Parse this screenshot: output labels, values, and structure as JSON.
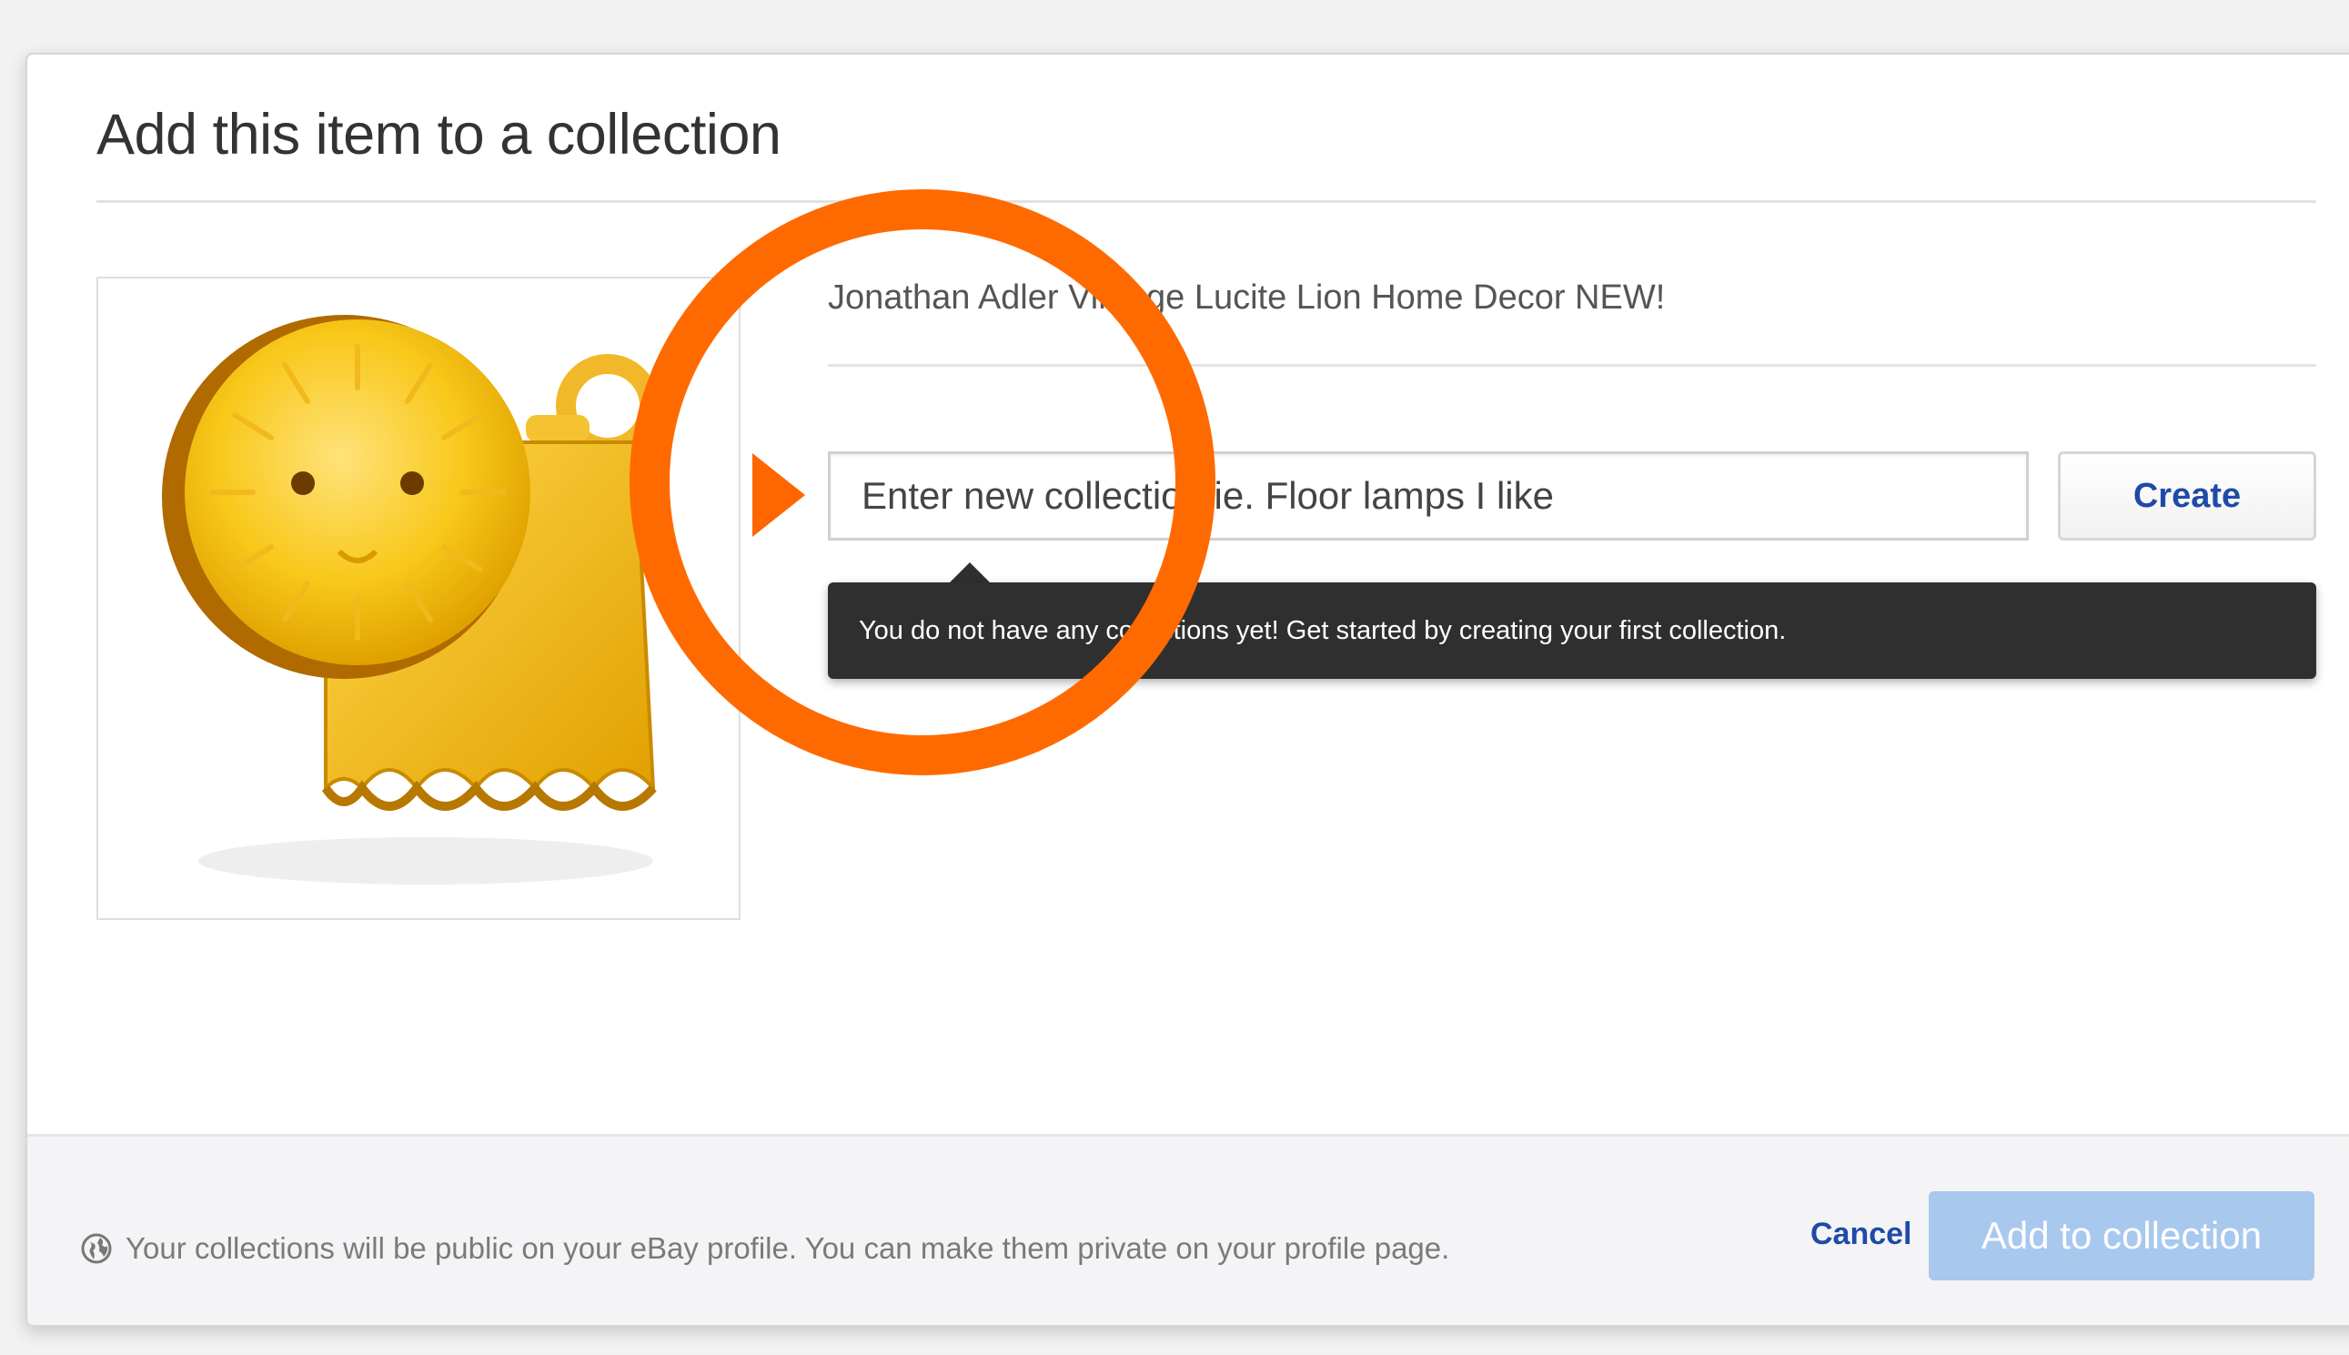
{
  "dialog": {
    "title": "Add this item to a collection"
  },
  "item": {
    "title": "Jonathan Adler Vintage Lucite Lion Home Decor NEW!",
    "image_alt": "Yellow lucite lion figurine"
  },
  "collection_form": {
    "input_placeholder": "Enter new collection ie. Floor lamps I like",
    "input_value": "",
    "create_label": "Create",
    "tooltip_text": "You do not have any collections yet! Get started by creating your first collection."
  },
  "footer": {
    "privacy_note": "Your collections will be public on your eBay profile. You can make them private on your profile page.",
    "cancel_label": "Cancel",
    "add_label": "Add to collection"
  },
  "annotation": {
    "highlight_color": "#ff6a00"
  },
  "icons": {
    "privacy": "globe-icon",
    "pointer": "triangle-right-icon"
  },
  "colors": {
    "link_blue": "#1f4aa8",
    "primary_button_disabled": "#a8c8ee",
    "tooltip_bg": "#2f2f2f"
  }
}
